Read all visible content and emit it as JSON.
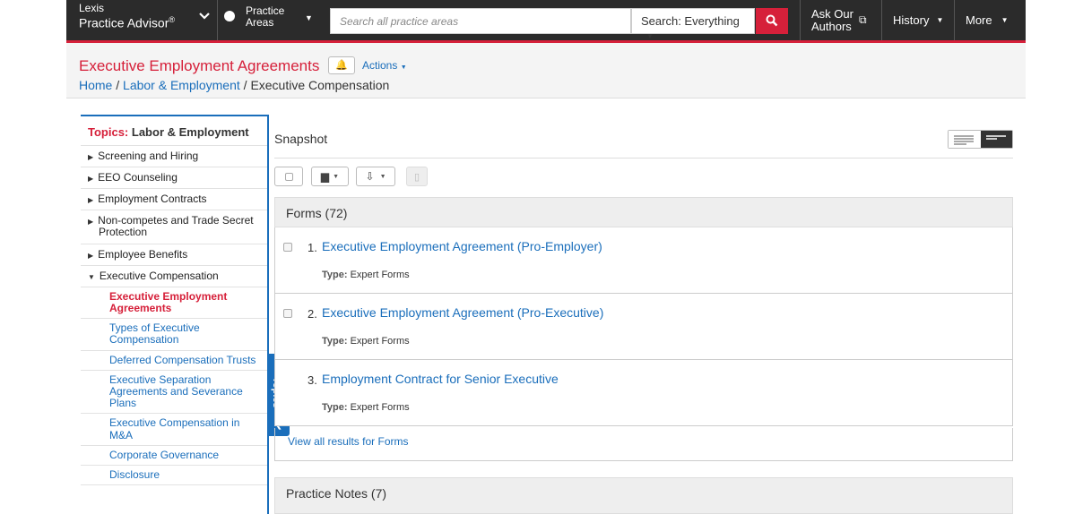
{
  "topnav": {
    "brand_line1": "Lexis",
    "brand_line2": "Practice Advisor",
    "brand_reg": "®",
    "practice_areas_line1": "Practice",
    "practice_areas_line2": "Areas",
    "search_placeholder": "Search all practice areas",
    "search_scope": "Search: Everything",
    "ask_line1": "Ask Our",
    "ask_line2": "Authors",
    "history": "History",
    "more": "More"
  },
  "header": {
    "title": "Executive Employment Agreements",
    "actions": "Actions",
    "breadcrumb": {
      "home": "Home",
      "sep1": " / ",
      "area": "Labor & Employment",
      "sep2": " / ",
      "current": "Executive Compensation"
    }
  },
  "topics": {
    "heading_prefix": "Topics:",
    "heading": "Labor & Employment",
    "items": [
      {
        "label": "Screening and Hiring"
      },
      {
        "label": "EEO Counseling"
      },
      {
        "label": "Employment Contracts"
      },
      {
        "label": "Non-competes and Trade Secret Protection"
      },
      {
        "label": "Employee Benefits"
      },
      {
        "label": "Executive Compensation"
      }
    ],
    "subitems": [
      {
        "label": "Executive Employment Agreements"
      },
      {
        "label": "Types of Executive Compensation"
      },
      {
        "label": "Deferred Compensation Trusts"
      },
      {
        "label": "Executive Separation Agreements and Severance Plans"
      },
      {
        "label": "Executive Compensation in M&A"
      },
      {
        "label": "Corporate Governance"
      },
      {
        "label": "Disclosure"
      }
    ],
    "tab_label": "Topics"
  },
  "main": {
    "snapshot": "Snapshot",
    "forms_heading": "Forms (72)",
    "results": [
      {
        "num": "1.",
        "title": "Executive Employment Agreement (Pro-Employer)",
        "type_label": "Type:",
        "type": "Expert Forms"
      },
      {
        "num": "2.",
        "title": "Executive Employment Agreement (Pro-Executive)",
        "type_label": "Type:",
        "type": "Expert Forms"
      },
      {
        "num": "3.",
        "title": "Employment Contract for Senior Executive",
        "type_label": "Type:",
        "type": "Expert Forms"
      }
    ],
    "view_all": "View all results for Forms",
    "notes_heading": "Practice Notes (7)"
  },
  "colors": {
    "accent_red": "#d6203a",
    "link_blue": "#1a6ebb",
    "nav_dark": "#2b2b2b"
  }
}
